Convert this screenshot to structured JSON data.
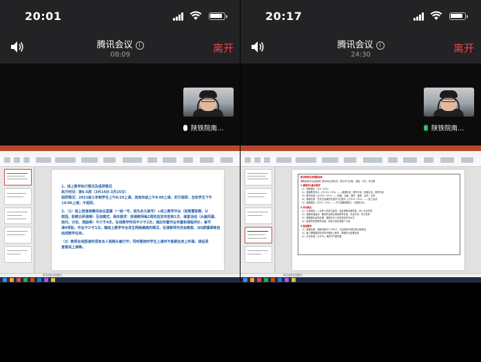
{
  "left": {
    "status": {
      "time": "20:01"
    },
    "meeting": {
      "title": "腾讯会议",
      "elapsed": "08:09",
      "leave_label": "离开"
    },
    "participant": {
      "name": "陕铁院南…"
    },
    "slide": {
      "lines": [
        "1、线上教学执行情况及组研情况",
        "执行时间：第6-5周（3月14日-3月25日）",
        "组研情况：2021级三年制学生上午8:20上课，其他年级上午8:00上课，实行组研；全体学生下午",
        "14:00上课，不组研。",
        "2、（1）线上授课用腾讯会议直播（一班一号，班为永久账号）+线上教学平台（如智慧职教、U",
        "校园、职教云研课等）互动模式，相关要求：授课教师每2周的应发布签到1次，课堂活动（头脑风暴、",
        "抢问、讨论、测验等）不少于4次，在线教学时间不少于2次；课后布置作业布置和课程评价，每节",
        "课4项检，作业不少于1次。辅线上教学平台发生网络瘫痪的情况，任课教师可改会教案、QQ群播课等自",
        "完成教学任务。",
        "（2）教师在线授课时须有本人视频头像打开；同时要按时学生上课时不能刷在床上听课，课后须",
        "查看完上课等。"
      ]
    },
    "statusbar": {
      "notes": "单击此处添加备注"
    }
  },
  "right": {
    "status": {
      "time": "20:17"
    },
    "meeting": {
      "title": "腾讯会议",
      "elapsed": "24:30",
      "leave_label": "离开"
    },
    "participant": {
      "name": "陕铁院南…"
    },
    "doc": {
      "heading": "职业教育在线课程标准",
      "lines": [
        "课程资源平台应用能力的目标达成情况，统计学习过程、测验、讨论、作业等",
        "1.课程评价基本要求",
        "（1）课程团队（占5~10%）",
        "（2）课程教学设计（占15%~25%）——课程标准、教学计划、授课计划、教学内容",
        "（3）教学资源（占20%~35%）——视频、动画、课件、题库、素材、文档",
        "（4）课程应用：在学生选课的在线学习过程中（占35%~35%）——线上活动",
        "（5）课程团队（占5%~10%）——学习通数据统计、过程性评价",
        "2.评价要点",
        "（1）认真组织——全体人员参与建设，保证课程资源质量，进入平台完成",
        "（2）课程资源建设：要求符合职业院校教学标准，内容丰富、形式多样",
        "（3）课程团队结构合理，课程负责人具有较高学术水平",
        "（4）能提供优质教学资源，具有示范性和推广价值",
        "3.指标要求",
        "（1）课程资源：视频总数不少于60个，包含教学内容的重点和难点",
        "（2）每门课程要求在校内开展线上教学，课程评价结果优良",
        "（3）文本资源（占30%）课件PPT要完整"
      ]
    },
    "statusbar": {
      "notes": "单击此处添加备注"
    }
  }
}
